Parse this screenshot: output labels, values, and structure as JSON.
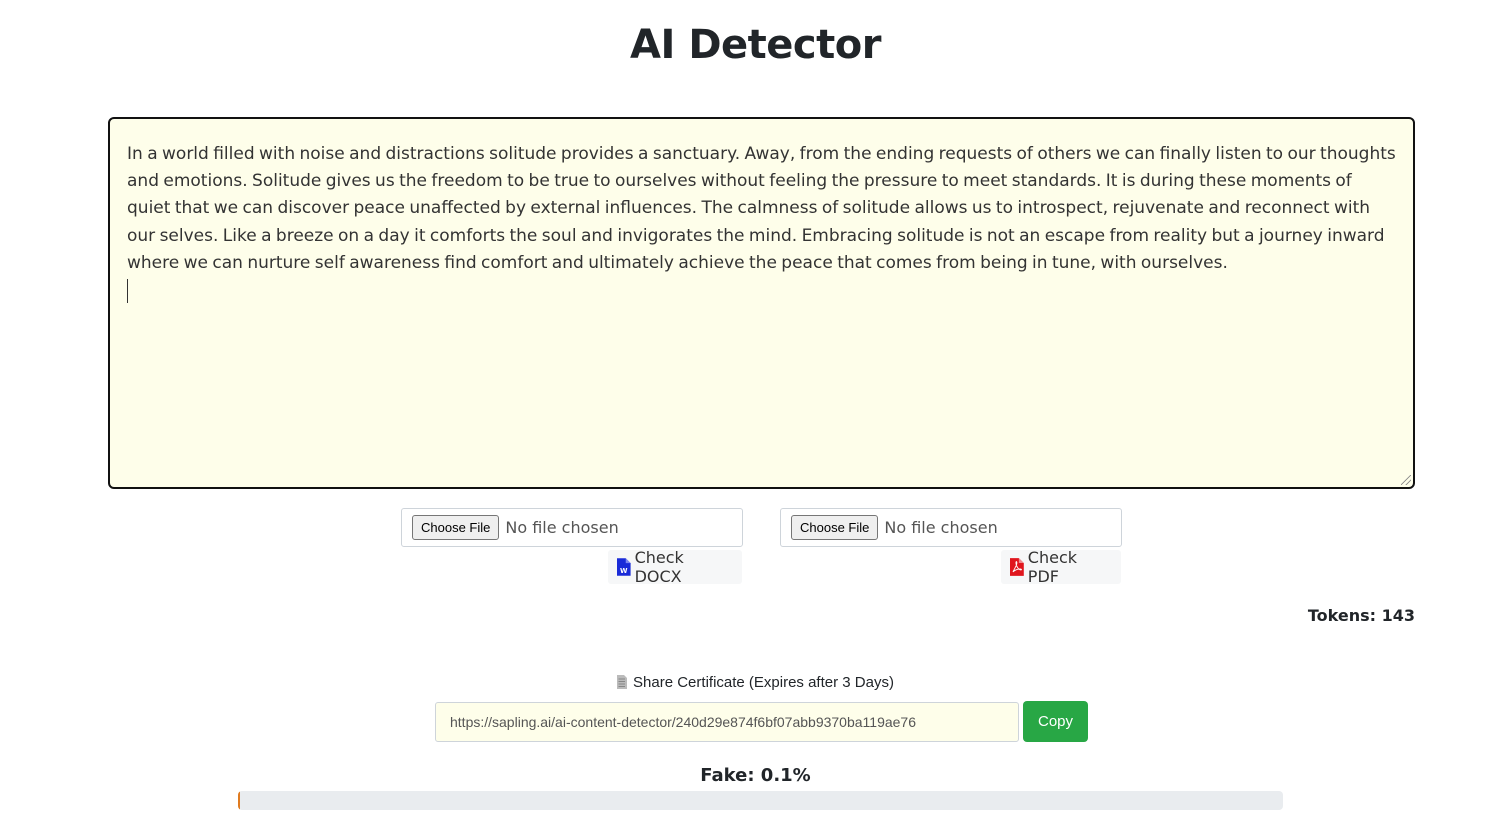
{
  "page": {
    "title": "AI Detector"
  },
  "editor": {
    "text": "In a world filled with noise and distractions solitude provides a sanctuary. Away, from the ending requests of others we can finally listen to our thoughts and emotions. Solitude gives us the freedom to be true to ourselves without feeling the pressure to meet standards. It is during these moments of quiet that we can discover peace unaffected by external influences. The calmness of solitude allows us to introspect, rejuvenate and reconnect with our selves. Like a breeze on a day it comforts the soul and invigorates the mind. Embracing solitude is not an escape from reality but a journey inward where we can nurture self awareness find comfort and ultimately achieve the peace that comes from being in tune, with ourselves.",
    "background": "#fefeea"
  },
  "upload": {
    "docx": {
      "choose_label": "Choose File",
      "status": "No file chosen",
      "check_label": "Check DOCX",
      "icon": "word-file-icon",
      "icon_color": "#1a2bd8"
    },
    "pdf": {
      "choose_label": "Choose File",
      "status": "No file chosen",
      "check_label": "Check PDF",
      "icon": "pdf-file-icon",
      "icon_color": "#e0161e"
    }
  },
  "tokens": {
    "label": "Tokens: 143"
  },
  "share": {
    "label": "Share Certificate (Expires after 3 Days)",
    "icon": "document-icon",
    "url": "https://sapling.ai/ai-content-detector/240d29e874f6bf07abb9370ba119ae76",
    "copy_label": "Copy",
    "copy_color": "#28a745"
  },
  "result": {
    "fake_label": "Fake: 0.1%",
    "fake_percent": 0.1,
    "bar_color": "#e07b20"
  }
}
